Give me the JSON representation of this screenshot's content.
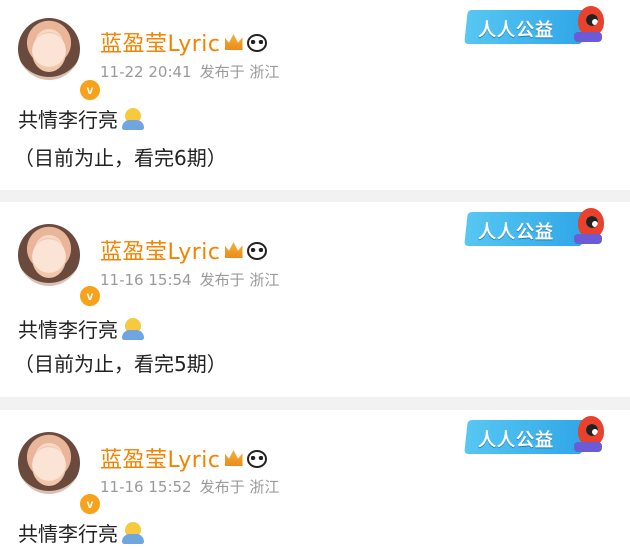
{
  "posts": [
    {
      "author": "蓝盈莹Lyric",
      "time": "11-22 20:41",
      "source": "发布于 浙江",
      "badge": "人人公益",
      "text": "共情李行亮",
      "note": "（目前为止，看完6期）"
    },
    {
      "author": "蓝盈莹Lyric",
      "time": "11-16 15:54",
      "source": "发布于 浙江",
      "badge": "人人公益",
      "text": "共情李行亮",
      "note": "（目前为止，看完5期）"
    },
    {
      "author": "蓝盈莹Lyric",
      "time": "11-16 15:52",
      "source": "发布于 浙江",
      "badge": "人人公益",
      "text": "共情李行亮",
      "note": ""
    }
  ],
  "icons": {
    "verified": "verified-v-icon",
    "crown": "crown-icon",
    "panda": "panda-icon",
    "emoji": "hug-emoji-icon"
  },
  "colors": {
    "name": "#f68200",
    "meta": "#9a9a9a",
    "badge": "#2fa6e8",
    "separator": "#f2f2f2"
  }
}
